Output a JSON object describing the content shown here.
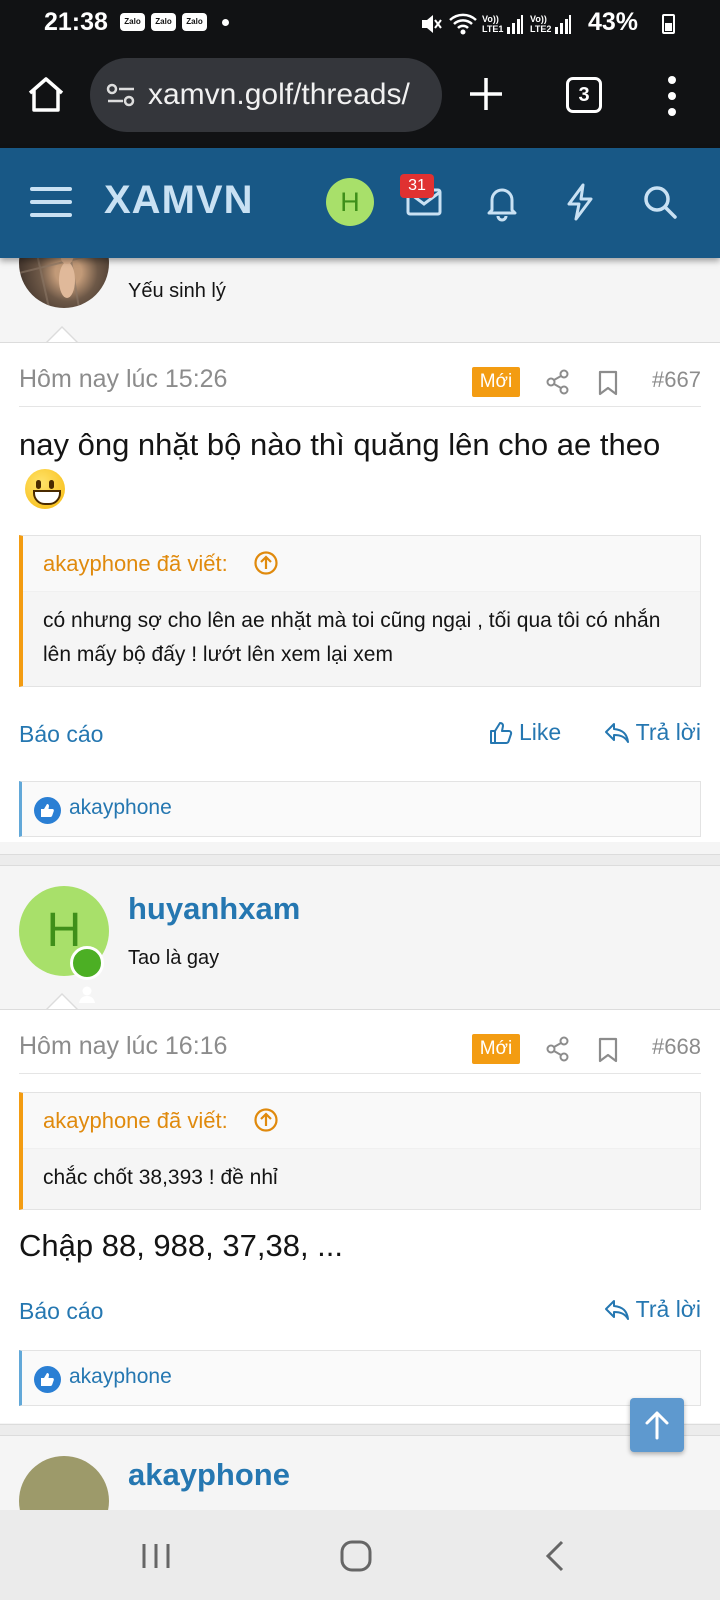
{
  "status_bar": {
    "time": "21:38",
    "notifications": [
      "Zalo",
      "Zalo",
      "Zalo"
    ],
    "battery": "43%",
    "signal_labels": [
      "Vo)) LTE1",
      "Vo)) LTE2"
    ]
  },
  "browser": {
    "url": "xamvn.golf/threads/",
    "tab_count": "3"
  },
  "site_header": {
    "logo": "XAMVN",
    "avatar_letter": "H",
    "inbox_badge": "31",
    "colors": {
      "header_bg": "#185886",
      "link": "#2577b1",
      "new_badge": "#f39c12"
    }
  },
  "posts": [
    {
      "user_title": "Yếu sinh lý",
      "date": "Hôm nay lúc 15:26",
      "new_label": "Mới",
      "number": "#667",
      "body": "nay ông nhặt bộ nào thì quăng lên cho ae theo",
      "quote": {
        "author": "akayphone đã viết:",
        "text": "có nhưng sợ cho lên ae nhặt mà toi cũng ngại , tối qua tôi có nhắn lên mấy bộ đấy ! lướt lên xem lại xem"
      },
      "report": "Báo cáo",
      "like": "Like",
      "reply": "Trả lời",
      "reaction_user": "akayphone"
    },
    {
      "username": "huyanhxam",
      "avatar_letter": "H",
      "user_title": "Tao là gay",
      "date": "Hôm nay lúc 16:16",
      "new_label": "Mới",
      "number": "#668",
      "quote": {
        "author": "akayphone đã viết:",
        "text": "chắc chốt 38,393 ! đề nhỉ"
      },
      "body": "Chập 88, 988, 37,38, ...",
      "report": "Báo cáo",
      "reply": "Trả lời",
      "reaction_user": "akayphone"
    },
    {
      "username": "akayphone"
    }
  ]
}
